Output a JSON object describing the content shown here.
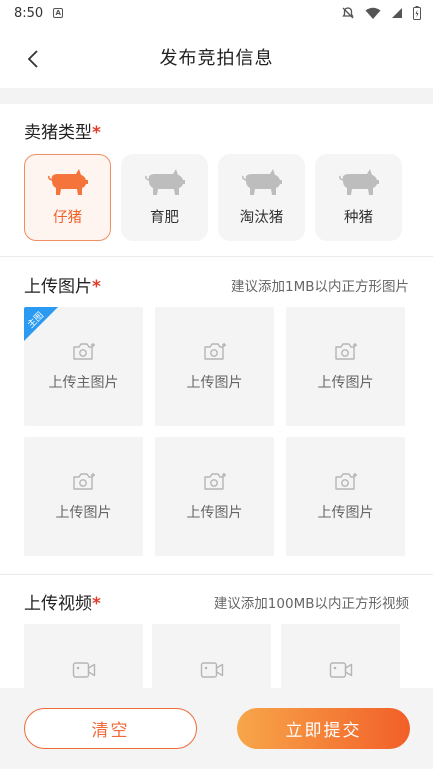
{
  "status_bar": {
    "time": "8:50",
    "notification_badge": "A"
  },
  "nav": {
    "title": "发布竞拍信息"
  },
  "pig_type": {
    "title": "卖猪类型",
    "required_mark": "*",
    "options": [
      {
        "label": "仔猪",
        "selected": true
      },
      {
        "label": "育肥",
        "selected": false
      },
      {
        "label": "淘汰猪",
        "selected": false
      },
      {
        "label": "种猪",
        "selected": false
      }
    ]
  },
  "upload_images": {
    "title": "上传图片",
    "required_mark": "*",
    "hint": "建议添加1MB以内正方形图片",
    "main_badge": "主图",
    "tiles": [
      "上传主图片",
      "上传图片",
      "上传图片",
      "上传图片",
      "上传图片",
      "上传图片"
    ]
  },
  "upload_video": {
    "title": "上传视频",
    "required_mark": "*",
    "hint": "建议添加100MB以内正方形视频"
  },
  "actions": {
    "clear": "清空",
    "submit": "立即提交"
  },
  "colors": {
    "accent": "#f06a3a",
    "ribbon": "#2b9af3",
    "required": "#e23b2a"
  }
}
